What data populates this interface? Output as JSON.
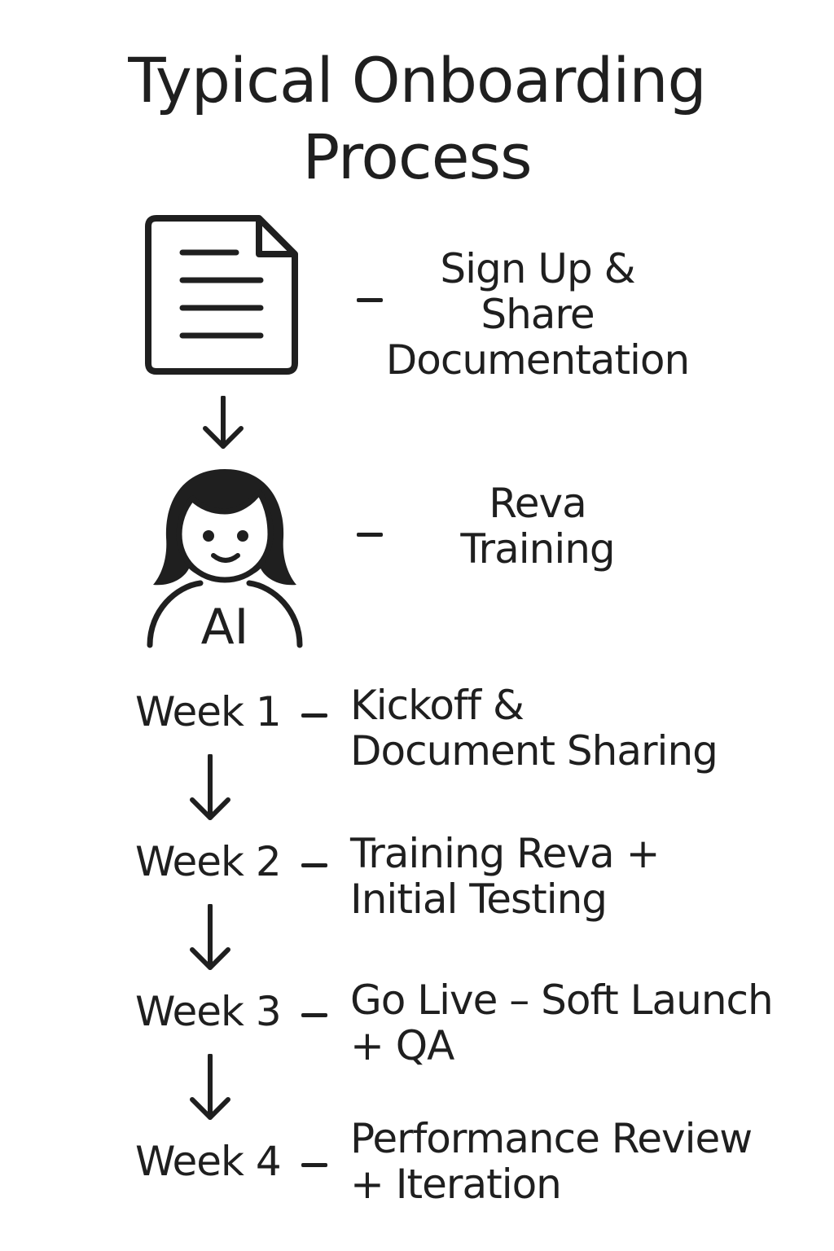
{
  "title": {
    "line1": "Typical Onboarding",
    "line2": "Process"
  },
  "top_steps": [
    {
      "icon": "document-icon",
      "lines": [
        "Sign Up &",
        "Share",
        "Documentation"
      ]
    },
    {
      "icon": "ai-avatar-icon",
      "icon_text": "AI",
      "lines": [
        "Reva",
        "Training"
      ]
    }
  ],
  "weeks": [
    {
      "label": "Week 1",
      "lines": [
        "Kickoff &",
        "Document Sharing"
      ]
    },
    {
      "label": "Week 2",
      "lines": [
        "Training Reva +",
        "Initial Testing"
      ]
    },
    {
      "label": "Week 3",
      "lines": [
        "Go Live – Soft Launch",
        "+ QA"
      ]
    },
    {
      "label": "Week 4",
      "lines": [
        "Performance Review",
        "+ Iteration"
      ]
    }
  ],
  "colors": {
    "ink": "#1f1f1f",
    "background": "#ffffff"
  }
}
